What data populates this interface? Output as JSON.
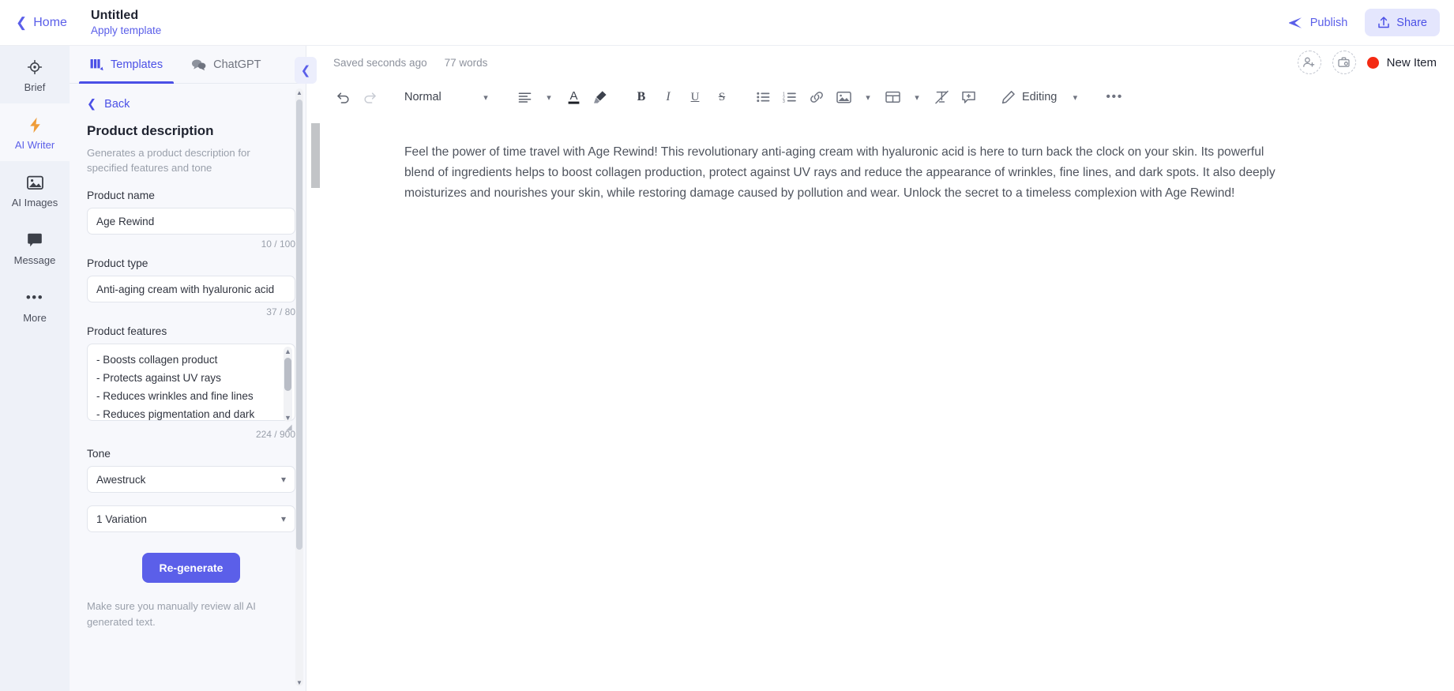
{
  "header": {
    "home_label": "Home",
    "doc_title": "Untitled",
    "apply_template": "Apply template",
    "publish_label": "Publish",
    "share_label": "Share"
  },
  "rail": {
    "items": [
      {
        "label": "Brief",
        "icon": "target-icon",
        "active": false
      },
      {
        "label": "AI Writer",
        "icon": "lightning-icon",
        "active": true
      },
      {
        "label": "AI Images",
        "icon": "image-icon",
        "active": false
      },
      {
        "label": "Message",
        "icon": "message-icon",
        "active": false
      },
      {
        "label": "More",
        "icon": "ellipsis-icon",
        "active": false
      }
    ]
  },
  "panel": {
    "tabs": [
      {
        "label": "Templates",
        "icon": "templates-icon",
        "active": true
      },
      {
        "label": "ChatGPT",
        "icon": "chat-bubbles-icon",
        "active": false
      }
    ],
    "back_label": "Back",
    "template_title": "Product description",
    "template_desc": "Generates a product description for specified features and tone",
    "fields": {
      "product_name": {
        "label": "Product name",
        "value": "Age Rewind",
        "counter": "10 / 100"
      },
      "product_type": {
        "label": "Product type",
        "value": "Anti-aging cream with hyaluronic acid",
        "counter": "37 / 80"
      },
      "product_features": {
        "label": "Product features",
        "value": "- Boosts collagen product\n- Protects against UV rays\n- Reduces wrinkles and fine lines\n- Reduces pigmentation and dark",
        "counter": "224 / 900"
      },
      "tone": {
        "label": "Tone",
        "value": "Awestruck"
      },
      "variations": {
        "value": "1 Variation"
      }
    },
    "regenerate_label": "Re-generate",
    "disclaimer": "Make sure you manually review all AI generated text."
  },
  "editor": {
    "saved_status": "Saved seconds ago",
    "word_count": "77 words",
    "new_item_label": "New Item",
    "new_item_color": "#f42a13",
    "toolbar": {
      "style_label": "Normal",
      "editing_label": "Editing",
      "items": [
        "undo-icon",
        "redo-icon",
        "align-icon",
        "text-color-icon",
        "highlight-icon",
        "bold-icon",
        "italic-icon",
        "underline-icon",
        "strikethrough-icon",
        "bullet-list-icon",
        "numbered-list-icon",
        "link-icon",
        "image-icon",
        "table-icon",
        "clear-format-icon",
        "comment-icon",
        "pencil-icon",
        "more-icon"
      ]
    },
    "document_text": "Feel the power of time travel with Age Rewind! This revolutionary anti-aging cream with hyaluronic acid is here to turn back the clock on your skin. Its powerful blend of ingredients helps to boost collagen production, protect against UV rays and reduce the appearance of wrinkles, fine lines, and dark spots. It also deeply moisturizes and nourishes your skin, while restoring damage caused by pollution and wear. Unlock the secret to a timeless complexion with Age Rewind!"
  },
  "colors": {
    "accent": "#5b5fe9",
    "panel_bg": "#f7f8fc",
    "rail_bg": "#eef1f8"
  }
}
